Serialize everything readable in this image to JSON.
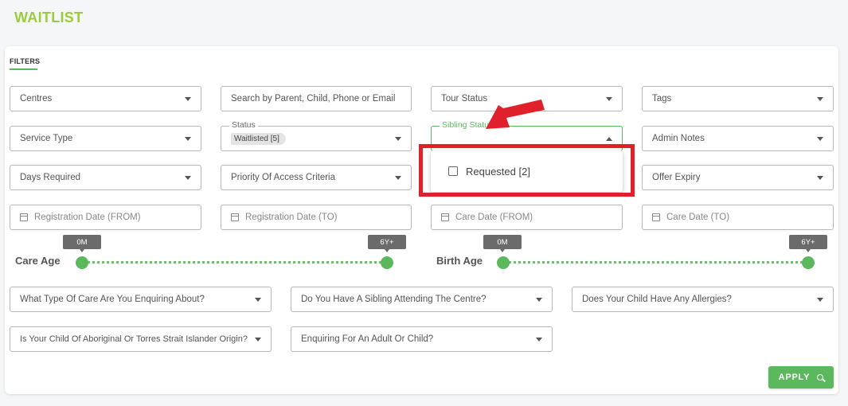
{
  "page": {
    "title": "WAITLIST"
  },
  "filters_tab": {
    "label": "FILTERS"
  },
  "row1": {
    "centres": "Centres",
    "search_placeholder": "Search by Parent, Child, Phone or Email",
    "tour_status": "Tour Status",
    "tags": "Tags"
  },
  "row2": {
    "service_type": "Service Type",
    "status": {
      "legend": "Status",
      "chip": "Waitlisted [5]"
    },
    "sibling_status": {
      "legend": "Sibling Status"
    },
    "admin_notes": "Admin Notes"
  },
  "row3": {
    "days_required": "Days Required",
    "priority": "Priority Of Access Criteria",
    "offer_expiry": "Offer Expiry"
  },
  "dropdown": {
    "option": "Requested [2]"
  },
  "dates": {
    "reg_from": "Registration Date (FROM)",
    "reg_to": "Registration Date (TO)",
    "care_from": "Care Date (FROM)",
    "care_to": "Care Date (TO)"
  },
  "sliders": {
    "care_age": {
      "label": "Care Age",
      "min": "0M",
      "max": "6Y+"
    },
    "birth_age": {
      "label": "Birth Age",
      "min": "0M",
      "max": "6Y+"
    }
  },
  "questions": {
    "care_type": "What Type Of Care Are You Enquiring About?",
    "sibling": "Do You Have A Sibling Attending The Centre?",
    "allergies": "Does Your Child Have Any Allergies?",
    "aboriginal": "Is Your Child Of Aboriginal Or Torres Strait Islander Origin?",
    "adult_child": "Enquiring For An Adult Or Child?"
  },
  "apply": {
    "label": "APPLY"
  },
  "colors": {
    "accent": "#5cb85c",
    "title": "#9ccc3a",
    "highlight": "#e0202a"
  }
}
